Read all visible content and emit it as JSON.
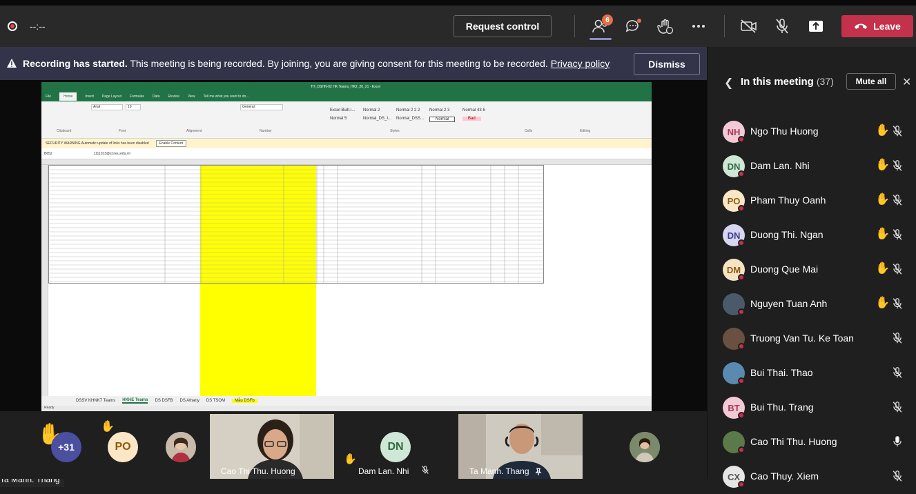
{
  "topbar": {
    "timer": "--:--",
    "request_control_label": "Request control",
    "participants_badge": "6",
    "leave_label": "Leave"
  },
  "banner": {
    "bold_text": "Recording has started.",
    "text": "This meeting is being recorded. By joining, you are giving consent for this meeting to be recorded.",
    "link_text": "Privacy policy",
    "dismiss_label": "Dismiss"
  },
  "shared_screen": {
    "presenter_name": "Ta Manh. Thang",
    "excel": {
      "title": "TH_DSHN-02 HK Teams_HK2_20_21 - Excel",
      "ribbon_tabs": [
        "File",
        "Home",
        "Insert",
        "Page Layout",
        "Formulas",
        "Data",
        "Review",
        "View",
        "Tell me what you want to do..."
      ],
      "font_name": "Arial",
      "font_size": "10",
      "number_format": "General",
      "styles": [
        "Excel Built-i...",
        "Normal 2",
        "Normal 2 2 2",
        "Normal 2 3",
        "Normal 43 6",
        "Normal 5",
        "Normal_DS_I...",
        "Normal_DSS...",
        "Normal",
        "Bad"
      ],
      "groups": [
        "Clipboard",
        "Font",
        "Alignment",
        "Number",
        "Styles",
        "Cells",
        "Editing"
      ],
      "security_warning": "SECURITY WARNING  Automatic update of links has been disabled",
      "enable_content": "Enable Content",
      "name_box": "B652",
      "formula_value": "1111013@st.neu.edu.vn",
      "sheet_tabs": [
        "DSSV KHNK7 Teams",
        "HKHE Teams",
        "DS DSFB",
        "DS Athany",
        "DS TSOM",
        "Mẫu DSFb"
      ],
      "active_sheet": "HKHE Teams",
      "highlight_sheet": "Mẫu DSFb",
      "status_ready": "Ready"
    }
  },
  "strip": {
    "others_count": "+31",
    "tiles": [
      {
        "initials": "PO"
      },
      {
        "initials": ""
      },
      {
        "name": "Cao Thi Thu. Huong"
      },
      {
        "initials": "DN",
        "name": "Dam Lan. Nhi"
      },
      {
        "name": "Ta Manh. Thang"
      },
      {
        "initials": ""
      }
    ]
  },
  "panel": {
    "title": "In this meeting",
    "count": "(37)",
    "mute_all_label": "Mute all",
    "participants": [
      {
        "initials": "NH",
        "name": "Ngo Thu Huong",
        "hand": true,
        "muted": true,
        "color": "#f4c9d6",
        "text": "#a03a5a"
      },
      {
        "initials": "DN",
        "name": "Dam Lan. Nhi",
        "hand": true,
        "muted": true,
        "color": "#cfe7d6",
        "text": "#2e6b3f"
      },
      {
        "initials": "PO",
        "name": "Pham Thuy Oanh",
        "hand": true,
        "muted": true,
        "color": "#fbe7c6",
        "text": "#8a5a10"
      },
      {
        "initials": "DN",
        "name": "Duong Thi. Ngan",
        "hand": true,
        "muted": true,
        "color": "#d6d6f0",
        "text": "#3a3a8a"
      },
      {
        "initials": "DM",
        "name": "Duong Que Mai",
        "hand": true,
        "muted": true,
        "color": "#f6e3c4",
        "text": "#8a5a10"
      },
      {
        "initials": "",
        "name": "Nguyen Tuan Anh",
        "hand": true,
        "muted": true,
        "color": "#4a5a6a",
        "text": "#fff"
      },
      {
        "initials": "",
        "name": "Truong Van Tu. Ke Toan",
        "hand": false,
        "muted": true,
        "color": "#6a5040",
        "text": "#fff"
      },
      {
        "initials": "",
        "name": "Bui Thai. Thao",
        "hand": false,
        "muted": true,
        "color": "#5a8ab0",
        "text": "#fff"
      },
      {
        "initials": "BT",
        "name": "Bui Thu. Trang",
        "hand": false,
        "muted": true,
        "color": "#f4c9d6",
        "text": "#a03a5a"
      },
      {
        "initials": "",
        "name": "Cao Thi Thu. Huong",
        "hand": false,
        "muted": false,
        "color": "#5a7a4a",
        "text": "#fff"
      },
      {
        "initials": "CX",
        "name": "Cao Thuy. Xiem",
        "hand": false,
        "muted": true,
        "color": "#e6e6e6",
        "text": "#555"
      }
    ]
  },
  "colors": {
    "leave": "#c4314b",
    "banner": "#33344a",
    "excel_green": "#217346",
    "highlight_yellow": "#ffff00"
  }
}
